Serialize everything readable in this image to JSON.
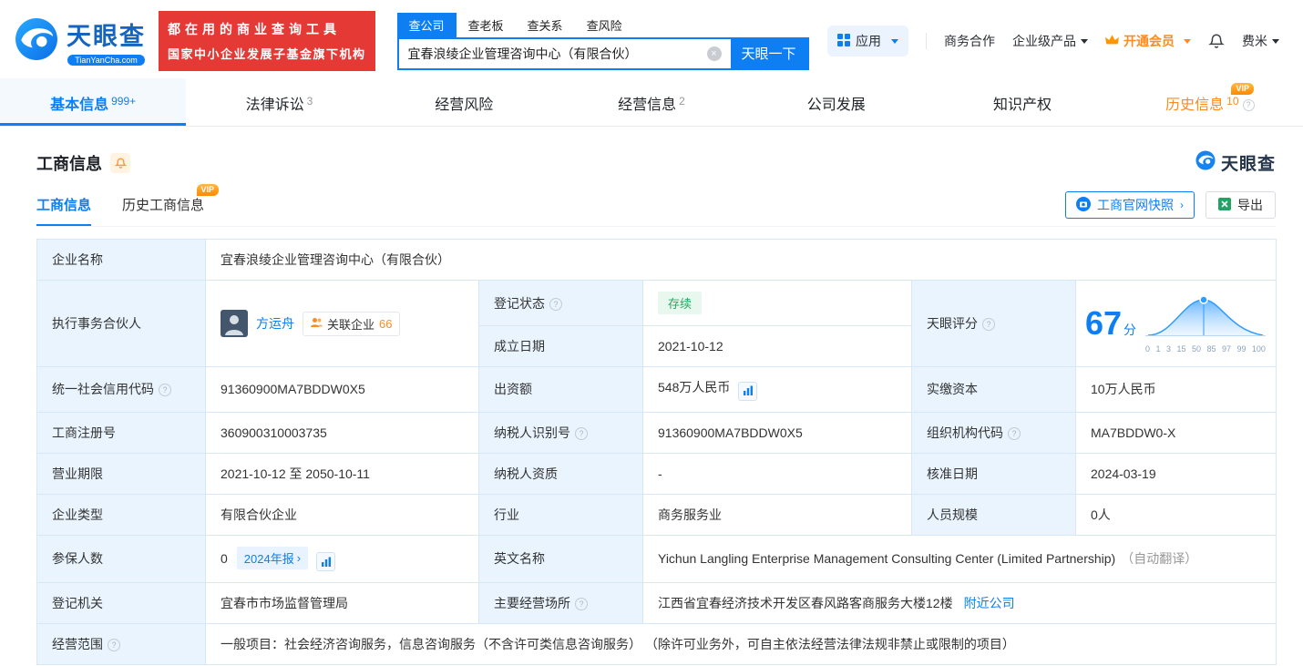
{
  "colors": {
    "accent_blue": "#0D7FF2",
    "brand_blue": "#1565C0",
    "banner_red": "#E53935",
    "vip_orange": "#FF8A1E",
    "status_green": "#27A85F",
    "label_cell_bg": "#E9F4FE",
    "table_border": "#D6E7F8"
  },
  "header": {
    "logo": {
      "brand": "天眼查",
      "domain": "TianYanCha.com"
    },
    "slogan": {
      "line1": "都在用的商业查询工具",
      "line2": "国家中小企业发展子基金旗下机构"
    },
    "search": {
      "tabs": [
        {
          "label": "查公司"
        },
        {
          "label": "查老板"
        },
        {
          "label": "查关系"
        },
        {
          "label": "查风险"
        }
      ],
      "value": "宜春浪绫企业管理咨询中心（有限合伙）",
      "button": "天眼一下"
    },
    "menu": {
      "apps": "应用",
      "cooperation": "商务合作",
      "products": "企业级产品",
      "vip": "开通会员",
      "user": "费米"
    }
  },
  "nav": {
    "tabs": [
      {
        "label": "基本信息",
        "badge": "999+"
      },
      {
        "label": "法律诉讼",
        "badge": "3"
      },
      {
        "label": "经营风险",
        "badge": ""
      },
      {
        "label": "经营信息",
        "badge": "2"
      },
      {
        "label": "公司发展",
        "badge": ""
      },
      {
        "label": "知识产权",
        "badge": ""
      },
      {
        "label": "历史信息",
        "badge": "10",
        "vip": "VIP"
      }
    ]
  },
  "section": {
    "title": "工商信息",
    "brand_watermark": "天眼查",
    "subtabs": [
      {
        "label": "工商信息"
      },
      {
        "label": "历史工商信息",
        "vip": "VIP"
      }
    ],
    "snapshot_button": "工商官网快照",
    "export_button": "导出"
  },
  "info": {
    "company_name": {
      "label": "企业名称",
      "value": "宜春浪绫企业管理咨询中心（有限合伙）"
    },
    "partner": {
      "label": "执行事务合伙人",
      "name": "方运舟",
      "related_label": "关联企业",
      "related_count": "66"
    },
    "reg_status": {
      "label": "登记状态",
      "value": "存续"
    },
    "establish_date": {
      "label": "成立日期",
      "value": "2021-10-12"
    },
    "score": {
      "label": "天眼评分",
      "value": "67",
      "unit": "分",
      "ticks": [
        "0",
        "1",
        "3",
        "15",
        "50",
        "85",
        "97",
        "99",
        "100"
      ]
    },
    "credit_code": {
      "label": "统一社会信用代码",
      "value": "91360900MA7BDDW0X5"
    },
    "capital": {
      "label": "出资额",
      "value": "548万人民币"
    },
    "paid_capital": {
      "label": "实缴资本",
      "value": "10万人民币"
    },
    "reg_number": {
      "label": "工商注册号",
      "value": "360900310003735"
    },
    "taxpayer_id": {
      "label": "纳税人识别号",
      "value": "91360900MA7BDDW0X5"
    },
    "org_code": {
      "label": "组织机构代码",
      "value": "MA7BDDW0-X"
    },
    "business_term": {
      "label": "营业期限",
      "value": "2021-10-12 至 2050-10-11"
    },
    "taxpayer_quality": {
      "label": "纳税人资质",
      "value": "-"
    },
    "approval_date": {
      "label": "核准日期",
      "value": "2024-03-19"
    },
    "company_type": {
      "label": "企业类型",
      "value": "有限合伙企业"
    },
    "industry": {
      "label": "行业",
      "value": "商务服务业"
    },
    "staff_size": {
      "label": "人员规模",
      "value": "0人"
    },
    "insured": {
      "label": "参保人数",
      "value": "0",
      "report_badge": "2024年报"
    },
    "english_name": {
      "label": "英文名称",
      "value": "Yichun Langling Enterprise Management Consulting Center (Limited Partnership)",
      "note": "（自动翻译）"
    },
    "reg_authority": {
      "label": "登记机关",
      "value": "宜春市市场监督管理局"
    },
    "address": {
      "label": "主要经营场所",
      "value": "江西省宜春经济技术开发区春风路客商服务大楼12楼",
      "link": "附近公司"
    },
    "scope": {
      "label": "经营范围",
      "value": "一般项目：社会经济咨询服务，信息咨询服务（不含许可类信息咨询服务） （除许可业务外，可自主依法经营法律法规非禁止或限制的项目）"
    }
  }
}
